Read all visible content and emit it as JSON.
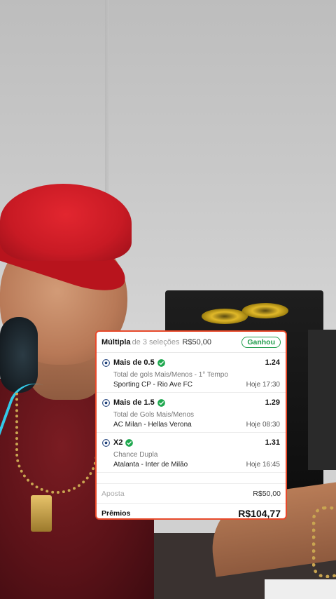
{
  "bet_slip": {
    "title": "Múltipla",
    "title_partial": "de 3 seleções",
    "stake_header": "R$50,00",
    "status": "Ganhou",
    "status_color": "#1f9d4b",
    "accent_border": "#e8492a",
    "selections": [
      {
        "market": "Mais de 0.5",
        "odds": "1.24",
        "type": "Total de gols Mais/Menos - 1° Tempo",
        "match": "Sporting CP - Rio Ave FC",
        "time": "Hoje 17:30",
        "icon": "soccer-ball-icon",
        "result_icon": "check-circle-icon"
      },
      {
        "market": "Mais de 1.5",
        "odds": "1.29",
        "type": "Total de Gols Mais/Menos",
        "match": "AC Milan - Hellas Verona",
        "time": "Hoje 08:30",
        "icon": "soccer-ball-icon",
        "result_icon": "check-circle-icon"
      },
      {
        "market": "X2",
        "odds": "1.31",
        "type": "Chance Dupla",
        "match": "Atalanta - Inter de Milão",
        "time": "Hoje 16:45",
        "icon": "soccer-ball-icon",
        "result_icon": "check-circle-icon"
      }
    ],
    "stake_label": "Aposta",
    "stake_value": "R$50,00",
    "prize_label": "Prêmios",
    "prize_value": "R$104,77"
  }
}
